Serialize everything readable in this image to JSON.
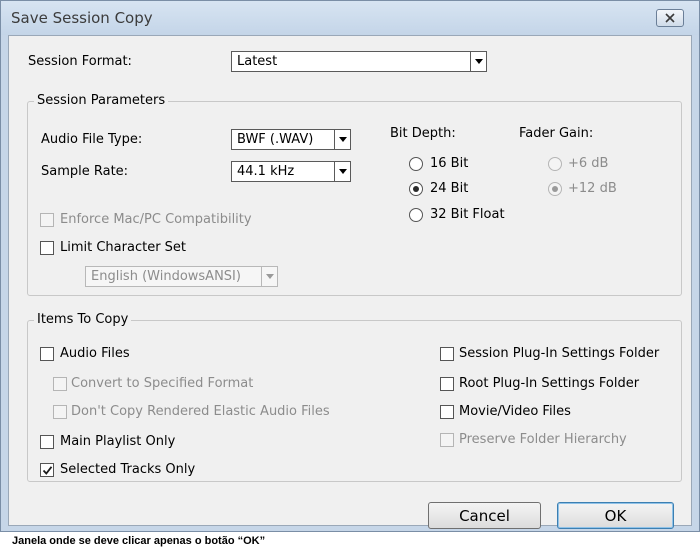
{
  "window": {
    "title": "Save Session Copy"
  },
  "session_format": {
    "label": "Session Format:",
    "value": "Latest"
  },
  "session_parameters": {
    "title": "Session Parameters",
    "audio_file_type": {
      "label": "Audio File Type:",
      "value": "BWF (.WAV)"
    },
    "sample_rate": {
      "label": "Sample Rate:",
      "value": "44.1 kHz"
    },
    "bit_depth": {
      "title": "Bit Depth:",
      "options": [
        {
          "label": "16 Bit",
          "selected": false
        },
        {
          "label": "24 Bit",
          "selected": true
        },
        {
          "label": "32 Bit Float",
          "selected": false
        }
      ]
    },
    "fader_gain": {
      "title": "Fader Gain:",
      "options": [
        {
          "label": "+6 dB",
          "selected": false
        },
        {
          "label": "+12 dB",
          "selected": true
        }
      ]
    },
    "enforce_compat": {
      "label": "Enforce Mac/PC Compatibility",
      "checked": false,
      "enabled": false
    },
    "limit_charset": {
      "label": "Limit Character Set",
      "checked": false,
      "enabled": true
    },
    "charset": {
      "value": "English (WindowsANSI)",
      "enabled": false
    }
  },
  "items_to_copy": {
    "title": "Items To Copy",
    "audio_files": {
      "label": "Audio Files",
      "checked": false
    },
    "convert_format": {
      "label": "Convert to Specified Format",
      "checked": false,
      "enabled": false
    },
    "dont_copy_elastic": {
      "label": "Don't Copy Rendered Elastic Audio Files",
      "checked": false,
      "enabled": false
    },
    "main_playlist": {
      "label": "Main Playlist Only",
      "checked": false
    },
    "selected_tracks": {
      "label": "Selected Tracks Only",
      "checked": true
    },
    "session_plugin": {
      "label": "Session Plug-In Settings Folder",
      "checked": false
    },
    "root_plugin": {
      "label": "Root Plug-In Settings Folder",
      "checked": false
    },
    "movie_video": {
      "label": "Movie/Video Files",
      "checked": false
    },
    "preserve_hierarchy": {
      "label": "Preserve Folder Hierarchy",
      "checked": false,
      "enabled": false
    }
  },
  "buttons": {
    "cancel": "Cancel",
    "ok": "OK"
  },
  "caption": "Janela onde se deve clicar apenas o botão “OK”",
  "colors": {
    "dialog_bg": "#f0f0f0",
    "frame": "#c6d6e8",
    "ok_border": "#3c7fb1"
  }
}
